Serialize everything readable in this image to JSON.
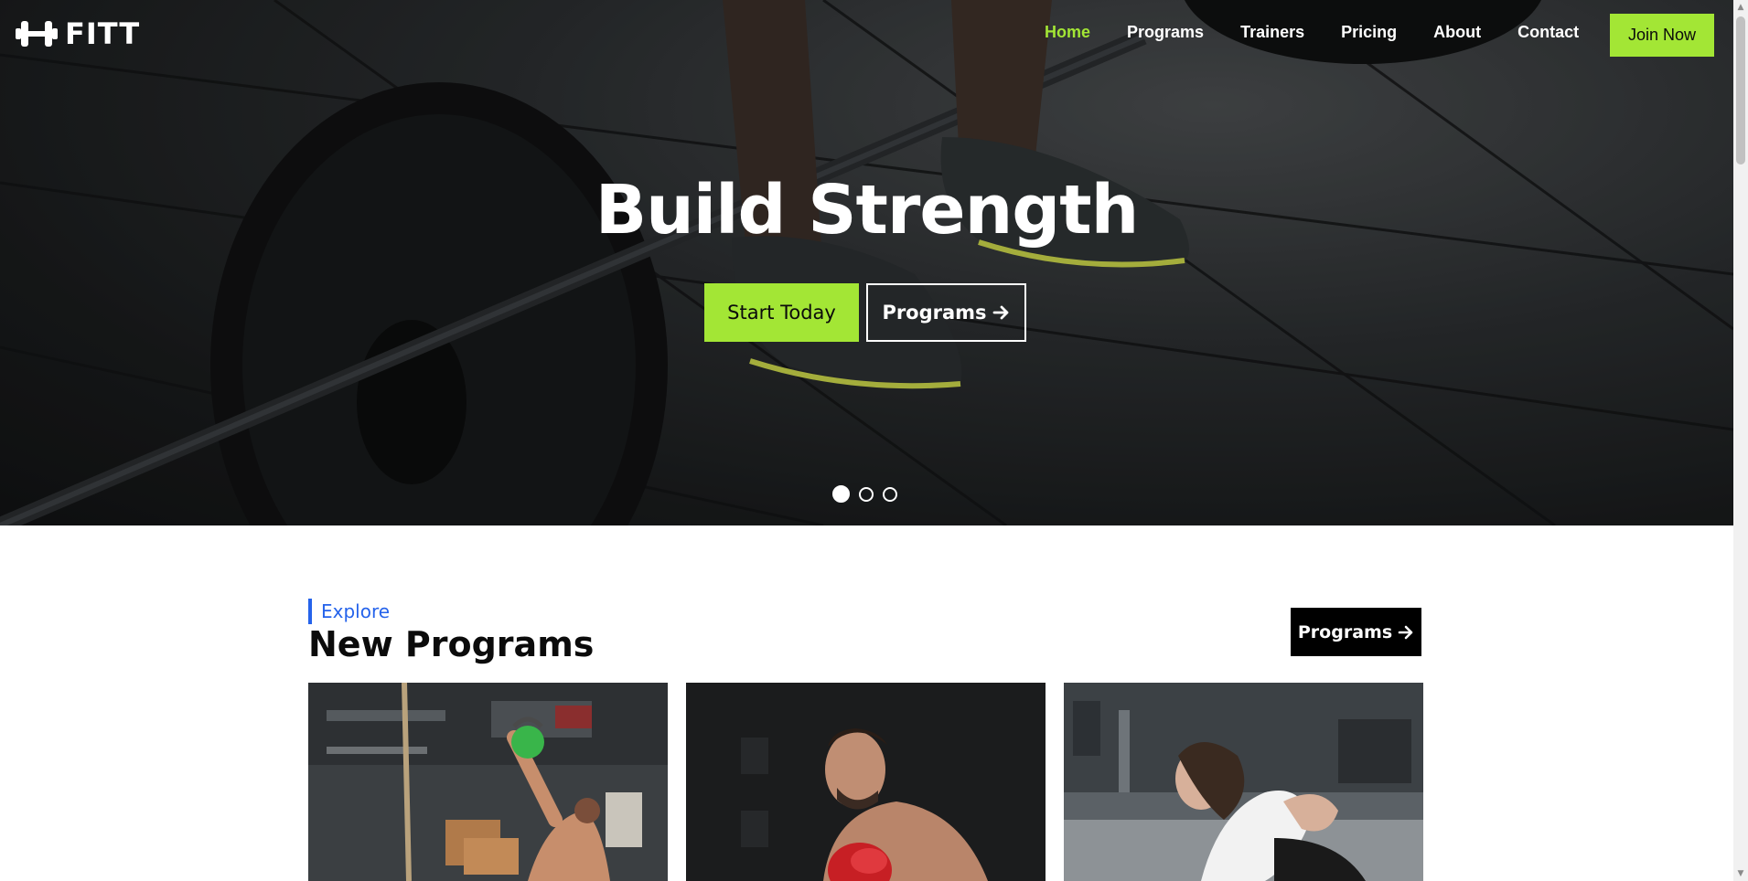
{
  "brand": {
    "name": "FITT",
    "accent": "#a3e635",
    "eyebrow_color": "#2563eb"
  },
  "nav": {
    "links": [
      {
        "label": "Home",
        "active": true
      },
      {
        "label": "Programs",
        "active": false
      },
      {
        "label": "Trainers",
        "active": false
      },
      {
        "label": "Pricing",
        "active": false
      },
      {
        "label": "About",
        "active": false
      },
      {
        "label": "Contact",
        "active": false
      }
    ],
    "cta": "Join Now"
  },
  "hero": {
    "title": "Build Strength",
    "primary_button": "Start Today",
    "secondary_button": "Programs",
    "secondary_icon": "arrow-right-icon",
    "slides": 3,
    "active_slide": 1
  },
  "section": {
    "eyebrow": "Explore",
    "title": "New Programs",
    "button": "Programs",
    "button_icon": "arrow-right-icon"
  },
  "cards": [
    {
      "image": "kettlebell-training-photo"
    },
    {
      "image": "boxing-training-photo"
    },
    {
      "image": "stretching-training-photo"
    }
  ]
}
